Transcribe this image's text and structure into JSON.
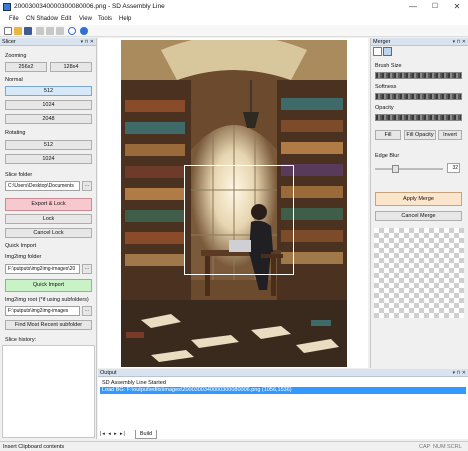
{
  "window": {
    "title": "2000300340000300080006.png - SD Assembly Line",
    "minimize": "—",
    "maximize": "☐",
    "close": "✕"
  },
  "menu": [
    "File",
    "CN Shadow",
    "Edit",
    "View",
    "Tools",
    "Help"
  ],
  "toolbar_icons": [
    "new-file-icon",
    "open-folder-icon",
    "save-icon",
    "cut-icon",
    "copy-icon",
    "paste-icon",
    "settings-icon",
    "help-icon"
  ],
  "slicer": {
    "title": "Slicer",
    "zooming_label": "Zooming",
    "zoom_256": "256x2",
    "zoom_128": "128x4",
    "normal_label": "Normal",
    "normal_512": "512",
    "normal_1024": "1024",
    "normal_2048": "2048",
    "rotating_label": "Rotating",
    "rot_512": "512",
    "rot_1024": "1024",
    "slice_folder_label": "Slice folder",
    "slice_folder_value": "C:\\Users\\Desktop\\Documents",
    "browse": "...",
    "export_lock": "Export & Lock",
    "lock": "Lock",
    "cancel_lock": "Cancel Lock",
    "quick_import_label": "Quick Import",
    "img2img_folder_label": "Img2img folder",
    "img2img_folder_value": "F:\\putputs\\img2img-images\\20",
    "quick_import": "Quick Import",
    "img2img_root_label": "Img2img root (*if using subfolders)",
    "img2img_root_value": "F:\\putputs\\img2img-images",
    "find_most_recent": "Find Most Recent subfolder",
    "history_label": "Slice history:"
  },
  "merger": {
    "title": "Merger",
    "brush_size_label": "Brush Size",
    "softness_label": "Softness",
    "opacity_label": "Opacity",
    "fill": "Fill",
    "fill_opacity": "Fill Opacity",
    "invert": "Invert",
    "edge_blur_label": "Edge Blur",
    "edge_blur_value": "32",
    "edge_blur_level": 0.3,
    "apply_merge": "Apply Merge",
    "cancel_merge": "Cancel Merge"
  },
  "output": {
    "title": "Output",
    "line1": "SD Assembly Line Started",
    "line2": "Load BG: F:\\output\\edits\\images\\2000300340000300080006.png (1056,1536)",
    "tab_build": "Build"
  },
  "status": {
    "left": "Insert Clipboard contents",
    "cap": "CAP",
    "num": "NUM",
    "scrl": "SCRL"
  },
  "colors": {
    "selection": "#3399ff",
    "panel_header": "#d9e3ef"
  }
}
